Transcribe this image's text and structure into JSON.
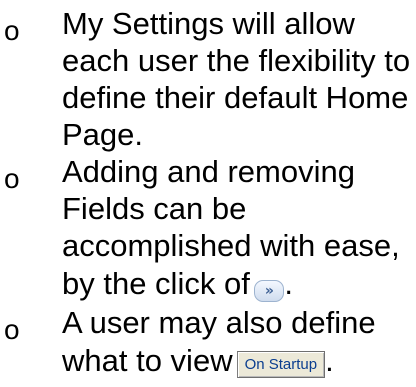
{
  "bullets": [
    {
      "marker": "o",
      "lines": [
        "My Settings will allow",
        "each user the flexibility to",
        "define their default Home",
        "Page."
      ]
    },
    {
      "marker": "o",
      "lines": [
        "Adding and removing",
        "Fields can be",
        "accomplished with ease,",
        "by the click of"
      ],
      "trailing": "."
    },
    {
      "marker": "o",
      "lines": [
        "A user may also define",
        "what to view"
      ],
      "trailing": "."
    }
  ],
  "buttons": {
    "add_field_label": "»",
    "on_startup_label": "On Startup"
  }
}
